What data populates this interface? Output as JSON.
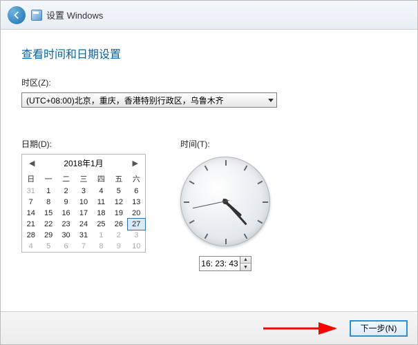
{
  "header": {
    "title": "设置 Windows"
  },
  "page": {
    "title": "查看时间和日期设置"
  },
  "timezone": {
    "label": "时区(Z):",
    "selected": "(UTC+08:00)北京，重庆，香港特别行政区，乌鲁木齐"
  },
  "date": {
    "label": "日期(D):",
    "month_title": "2018年1月",
    "dow": [
      "日",
      "一",
      "二",
      "三",
      "四",
      "五",
      "六"
    ],
    "selected_day": 27,
    "weeks": [
      [
        {
          "n": 31,
          "out": true
        },
        {
          "n": 1
        },
        {
          "n": 2
        },
        {
          "n": 3
        },
        {
          "n": 4
        },
        {
          "n": 5
        },
        {
          "n": 6
        }
      ],
      [
        {
          "n": 7
        },
        {
          "n": 8
        },
        {
          "n": 9
        },
        {
          "n": 10
        },
        {
          "n": 11
        },
        {
          "n": 12
        },
        {
          "n": 13
        }
      ],
      [
        {
          "n": 14
        },
        {
          "n": 15
        },
        {
          "n": 16
        },
        {
          "n": 17
        },
        {
          "n": 18
        },
        {
          "n": 19
        },
        {
          "n": 20
        }
      ],
      [
        {
          "n": 21
        },
        {
          "n": 22
        },
        {
          "n": 23
        },
        {
          "n": 24
        },
        {
          "n": 25
        },
        {
          "n": 26
        },
        {
          "n": 27
        }
      ],
      [
        {
          "n": 28
        },
        {
          "n": 29
        },
        {
          "n": 30
        },
        {
          "n": 31
        },
        {
          "n": 1,
          "out": true
        },
        {
          "n": 2,
          "out": true
        },
        {
          "n": 3,
          "out": true
        }
      ],
      [
        {
          "n": 4,
          "out": true
        },
        {
          "n": 5,
          "out": true
        },
        {
          "n": 6,
          "out": true
        },
        {
          "n": 7,
          "out": true
        },
        {
          "n": 8,
          "out": true
        },
        {
          "n": 9,
          "out": true
        },
        {
          "n": 10,
          "out": true
        }
      ]
    ]
  },
  "time": {
    "label": "时间(T):",
    "value": "16: 23: 43",
    "h": 16,
    "m": 23,
    "s": 43
  },
  "footer": {
    "next_label": "下一步(N)"
  }
}
